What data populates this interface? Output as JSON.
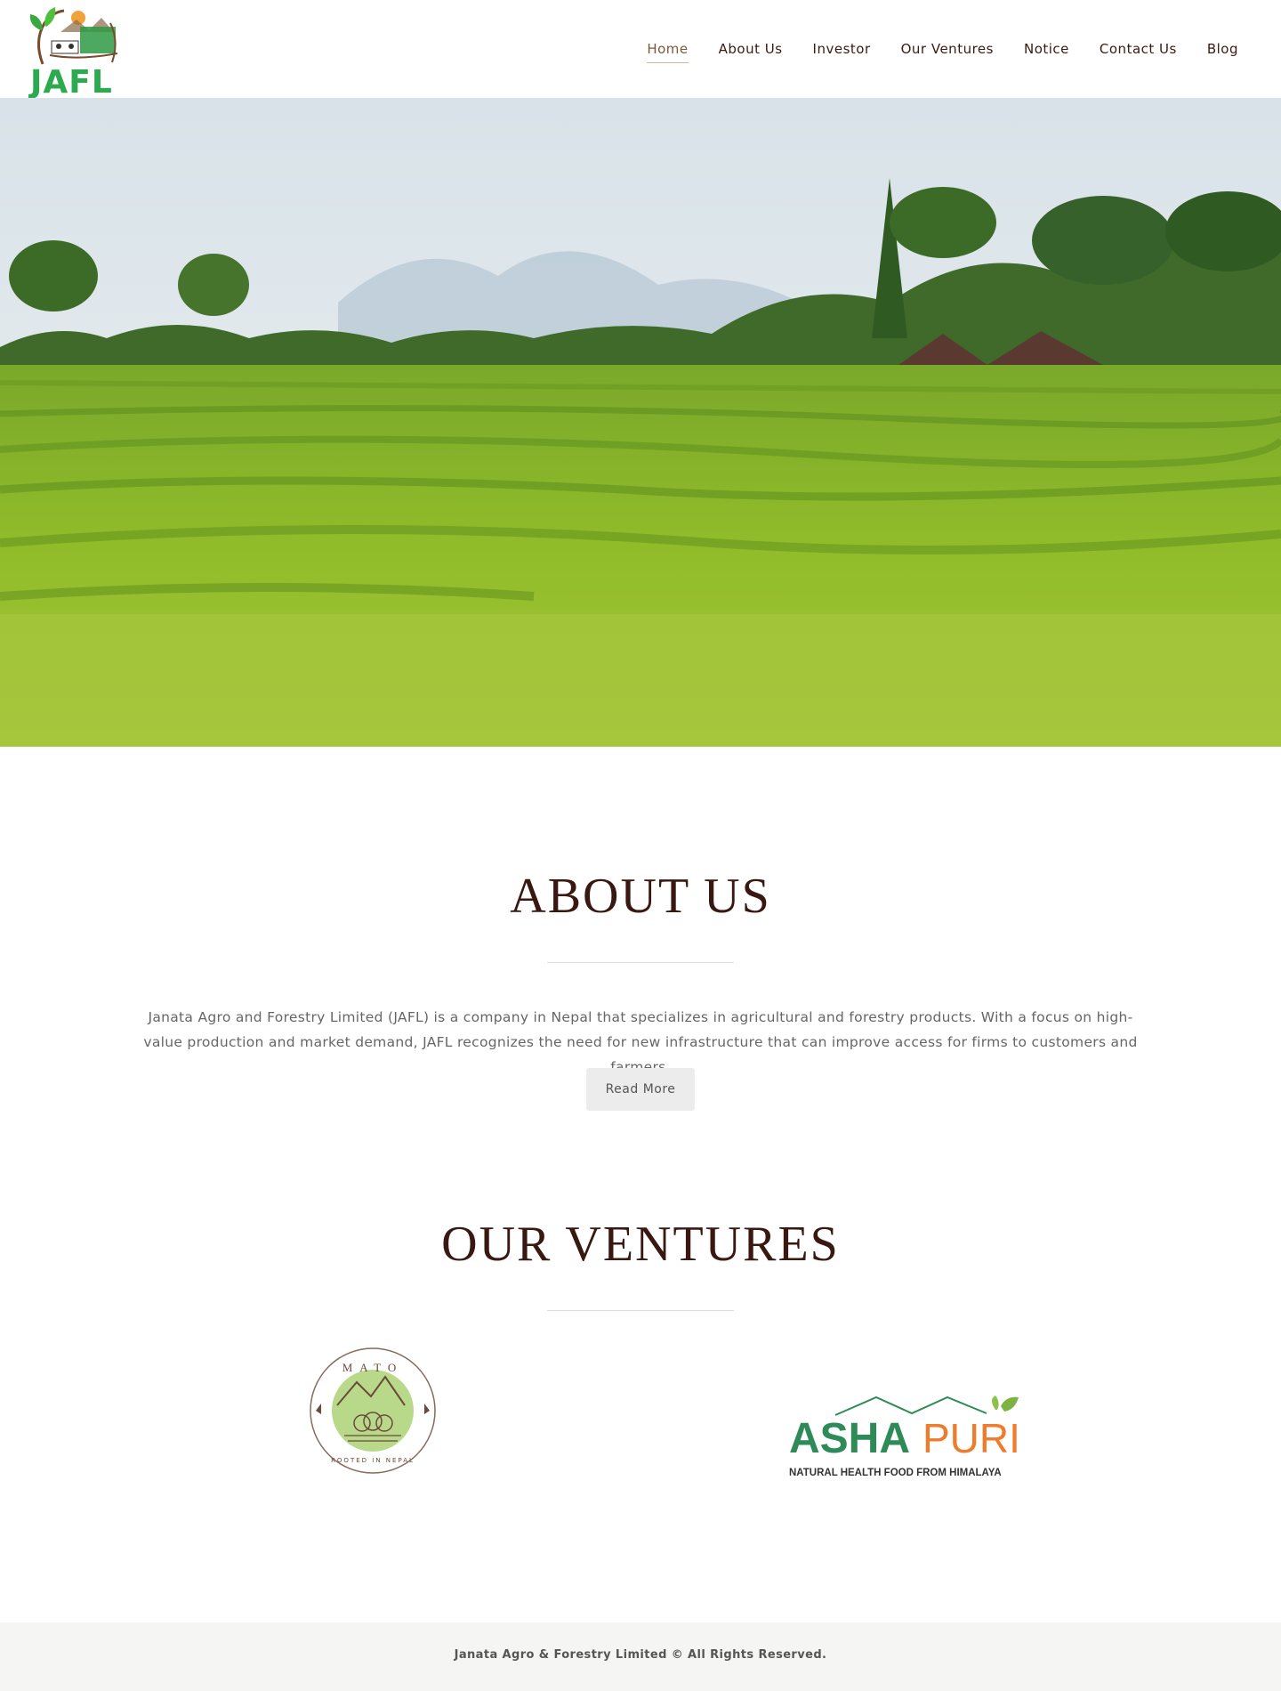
{
  "brand": {
    "logo_text": "JAFL",
    "accent": "#2daa4f"
  },
  "nav": {
    "items": [
      {
        "label": "Home",
        "active": true
      },
      {
        "label": "About Us"
      },
      {
        "label": "Investor"
      },
      {
        "label": "Our Ventures"
      },
      {
        "label": "Notice"
      },
      {
        "label": "Contact Us"
      },
      {
        "label": "Blog"
      }
    ]
  },
  "about": {
    "title": "ABOUT US",
    "text": "Janata Agro and Forestry Limited (JAFL) is a company in Nepal that specializes in agricultural and forestry products. With a focus on high-value production and market demand, JAFL recognizes the need for new infrastructure that can improve access for firms to customers and farmers.",
    "button": "Read More"
  },
  "ventures": {
    "title": "OUR VENTURES",
    "mato": {
      "name": "MATO",
      "tagline": "ROOTED IN NEPAL"
    },
    "ashapuri": {
      "name_left": "ASHA",
      "name_right": "PURI",
      "tagline": "NATURAL HEALTH FOOD FROM HIMALAYA"
    }
  },
  "footer": {
    "text": "Janata Agro & Forestry Limited © All Rights Reserved."
  }
}
